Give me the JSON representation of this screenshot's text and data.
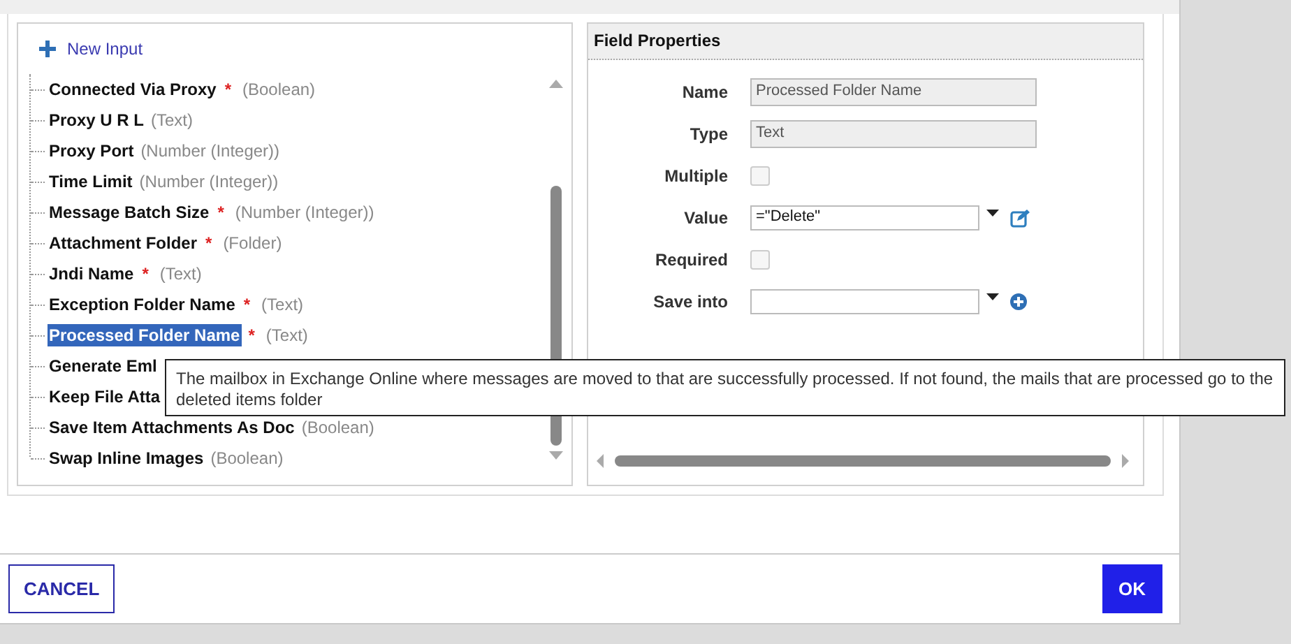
{
  "new_input": {
    "label": "New Input"
  },
  "inputs": [
    {
      "name": "Connected Via Proxy",
      "required_mark": "*",
      "type": "(Boolean)",
      "selected": false
    },
    {
      "name": "Proxy U R L",
      "type": "(Text)",
      "selected": false
    },
    {
      "name": "Proxy Port",
      "type": "(Number (Integer))",
      "selected": false
    },
    {
      "name": "Time Limit",
      "type": "(Number (Integer))",
      "selected": false
    },
    {
      "name": "Message Batch Size",
      "required_mark": "*",
      "type": "(Number (Integer))",
      "selected": false
    },
    {
      "name": "Attachment Folder",
      "required_mark": "*",
      "type": "(Folder)",
      "selected": false
    },
    {
      "name": "Jndi Name",
      "required_mark": "*",
      "type": "(Text)",
      "selected": false
    },
    {
      "name": "Exception Folder Name",
      "required_mark": "*",
      "type": "(Text)",
      "selected": false
    },
    {
      "name": "Processed Folder Name",
      "required_mark": "*",
      "type": "(Text)",
      "selected": true
    },
    {
      "name": "Generate Eml",
      "selected": false
    },
    {
      "name": "Keep File Atta",
      "selected": false
    },
    {
      "name": "Save Item Attachments As Doc",
      "type": "(Boolean)",
      "selected": false
    },
    {
      "name": "Swap Inline Images",
      "type": "(Boolean)",
      "selected": false
    }
  ],
  "field_properties": {
    "title": "Field Properties",
    "rows": [
      {
        "kind": "readonly",
        "label": "Name",
        "value": "Processed Folder Name"
      },
      {
        "kind": "readonly",
        "label": "Type",
        "value": "Text"
      },
      {
        "kind": "checkbox",
        "label": "Multiple",
        "checked": false
      },
      {
        "kind": "expression",
        "label": "Value",
        "value": "=\"Delete\""
      },
      {
        "kind": "checkbox",
        "label": "Required",
        "checked": false
      },
      {
        "kind": "target",
        "label": "Save into"
      }
    ]
  },
  "tooltip": "The mailbox in Exchange Online where messages are moved to that are successfully processed. If not found, the mails that are processed go to the deleted items folder",
  "buttons": {
    "cancel": "CANCEL",
    "ok": "OK"
  }
}
